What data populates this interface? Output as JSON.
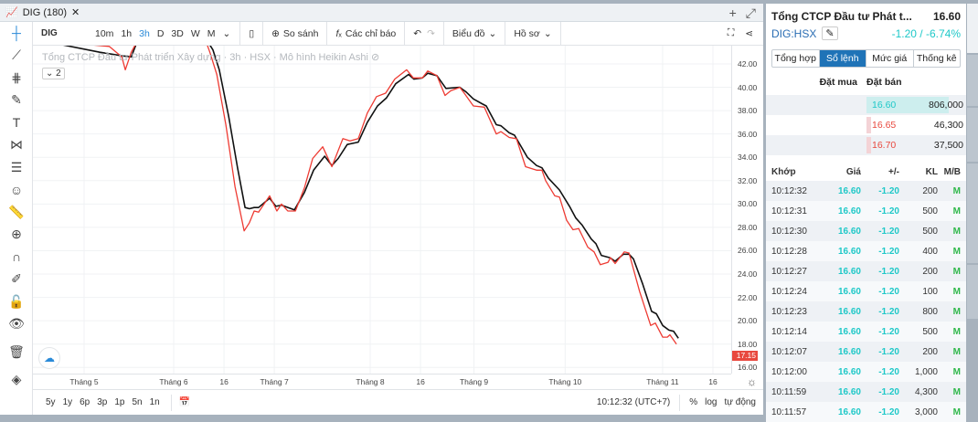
{
  "window": {
    "tab_title": "DIG (180)",
    "close": "✕",
    "add": "+",
    "expand": "⤢"
  },
  "toolbar": {
    "symbol": "DIG",
    "intervals": [
      "10m",
      "1h",
      "3h",
      "D",
      "3D",
      "W",
      "M"
    ],
    "active_interval": "3h",
    "compare": "So sánh",
    "indicators": "Các chỉ báo",
    "chart_type": "Biểu đồ",
    "profile": "Hồ sơ"
  },
  "legend": {
    "text": "Tổng CTCP Đầu tư Phát triển Xây dựng · 3h · HSX · Mô hình Heikin Ashi",
    "collapse": "2"
  },
  "bottom": {
    "ranges": [
      "5y",
      "1y",
      "6p",
      "3p",
      "1p",
      "5n",
      "1n"
    ],
    "clock": "10:12:32 (UTC+7)",
    "percent": "%",
    "log": "log",
    "auto": "tự động"
  },
  "chart_data": {
    "type": "line",
    "title": "Tổng CTCP Đầu tư Phát triển Xây dựng · 3h · HSX · Mô hình Heikin Ashi",
    "ylim": [
      15.5,
      43.5
    ],
    "y_ticks": [
      "42.00",
      "40.00",
      "38.00",
      "36.00",
      "34.00",
      "32.00",
      "30.00",
      "28.00",
      "26.00",
      "24.00",
      "22.00",
      "20.00",
      "18.00",
      "16.00"
    ],
    "x_ticks": [
      {
        "label": "Tháng 5",
        "x": 0
      },
      {
        "label": "Tháng 6",
        "x": 28.5
      },
      {
        "label": "16",
        "x": 44.5
      },
      {
        "label": "Tháng 7",
        "x": 60.5
      },
      {
        "label": "Tháng 8",
        "x": 91
      },
      {
        "label": "16",
        "x": 107
      },
      {
        "label": "Tháng 9",
        "x": 124
      },
      {
        "label": "Tháng 10",
        "x": 153
      },
      {
        "label": "Tháng 11",
        "x": 184
      },
      {
        "label": "16",
        "x": 200
      }
    ],
    "xlim": [
      -14,
      206
    ],
    "last_price": "17.15",
    "series": [
      {
        "name": "black",
        "color": "#111111",
        "points": [
          [
            -13.7,
            44
          ],
          [
            5,
            43
          ],
          [
            12,
            42.7
          ],
          [
            15,
            42.6
          ],
          [
            17,
            44
          ],
          [
            38,
            44.5
          ],
          [
            41,
            43.2
          ],
          [
            43,
            41.5
          ],
          [
            46,
            37.5
          ],
          [
            48.8,
            33.1
          ],
          [
            51.2,
            29.7
          ],
          [
            52.6,
            29.6
          ],
          [
            54.1,
            29.7
          ],
          [
            55.5,
            29.7
          ],
          [
            59,
            30.5
          ],
          [
            61,
            29.8
          ],
          [
            62.8,
            29.9
          ],
          [
            66.9,
            29.5
          ],
          [
            70.1,
            31
          ],
          [
            73,
            32.9
          ],
          [
            76.5,
            34.1
          ],
          [
            78.8,
            33.3
          ],
          [
            80.8,
            33.9
          ],
          [
            83.7,
            35.1
          ],
          [
            87.2,
            35.3
          ],
          [
            90.1,
            37
          ],
          [
            93.3,
            38.4
          ],
          [
            96.2,
            39.1
          ],
          [
            99.1,
            40.3
          ],
          [
            103.2,
            41.1
          ],
          [
            104.9,
            40.7
          ],
          [
            107.6,
            40.8
          ],
          [
            109.3,
            41.2
          ],
          [
            112.2,
            41
          ],
          [
            115.1,
            39.9
          ],
          [
            119.5,
            40
          ],
          [
            121.5,
            39.6
          ],
          [
            123.8,
            39
          ],
          [
            126.5,
            38.6
          ],
          [
            127.9,
            38.4
          ],
          [
            131.1,
            36.8
          ],
          [
            132.6,
            36.7
          ],
          [
            135.2,
            36.1
          ],
          [
            136.9,
            35.9
          ],
          [
            141,
            34
          ],
          [
            143.9,
            33.3
          ],
          [
            145.6,
            33.1
          ],
          [
            147.7,
            32.2
          ],
          [
            151.2,
            31.2
          ],
          [
            154.4,
            29.8
          ],
          [
            156.4,
            28.8
          ],
          [
            158.4,
            28.2
          ],
          [
            161.3,
            27
          ],
          [
            162.8,
            26.6
          ],
          [
            164.5,
            25.6
          ],
          [
            167.2,
            25.4
          ],
          [
            168.9,
            25.1
          ],
          [
            171.5,
            25.7
          ],
          [
            173.3,
            25.7
          ],
          [
            174.7,
            25.3
          ],
          [
            177.6,
            23.2
          ],
          [
            180.5,
            20.8
          ],
          [
            182,
            20.6
          ],
          [
            184,
            19.6
          ],
          [
            186,
            19.2
          ],
          [
            187.5,
            19.1
          ],
          [
            189,
            18.5
          ]
        ]
      },
      {
        "name": "red",
        "color": "#ee3b33",
        "points": [
          [
            -13.7,
            44
          ],
          [
            8,
            43.5
          ],
          [
            12,
            42.6
          ],
          [
            13.1,
            41.5
          ],
          [
            15,
            43
          ],
          [
            17,
            44
          ],
          [
            38,
            44.5
          ],
          [
            40,
            43
          ],
          [
            42.2,
            41.1
          ],
          [
            45.1,
            36.8
          ],
          [
            48,
            31.5
          ],
          [
            50.9,
            27.7
          ],
          [
            52.6,
            28.4
          ],
          [
            54.1,
            29.4
          ],
          [
            55.5,
            29.3
          ],
          [
            59,
            30.7
          ],
          [
            61.3,
            29.4
          ],
          [
            62.8,
            30
          ],
          [
            64.8,
            29.4
          ],
          [
            67.2,
            29.4
          ],
          [
            70.1,
            31.4
          ],
          [
            72.7,
            33.9
          ],
          [
            75.9,
            34.9
          ],
          [
            78.8,
            33.2
          ],
          [
            82.3,
            35.6
          ],
          [
            84.6,
            35.4
          ],
          [
            87.2,
            35.6
          ],
          [
            90.1,
            37.8
          ],
          [
            93,
            39.2
          ],
          [
            95.9,
            39.5
          ],
          [
            98.8,
            40.7
          ],
          [
            102.6,
            41.5
          ],
          [
            104.7,
            40.8
          ],
          [
            107.6,
            40.8
          ],
          [
            109.3,
            41.4
          ],
          [
            112.2,
            41
          ],
          [
            114.8,
            39.3
          ],
          [
            116.6,
            39.7
          ],
          [
            119.5,
            40
          ],
          [
            120.9,
            39.5
          ],
          [
            123.8,
            38.4
          ],
          [
            127.3,
            38.3
          ],
          [
            131.1,
            36
          ],
          [
            132.6,
            36.2
          ],
          [
            135.2,
            35.7
          ],
          [
            137.5,
            35.6
          ],
          [
            140.4,
            33.2
          ],
          [
            143.9,
            32.9
          ],
          [
            145.6,
            32.9
          ],
          [
            146.8,
            32
          ],
          [
            149.7,
            30.7
          ],
          [
            151.2,
            30.6
          ],
          [
            153.5,
            28.6
          ],
          [
            155.5,
            27.8
          ],
          [
            157.3,
            27.9
          ],
          [
            160.2,
            26.3
          ],
          [
            162.2,
            25.9
          ],
          [
            164.2,
            24.8
          ],
          [
            166.6,
            25
          ],
          [
            167.4,
            25.4
          ],
          [
            168.9,
            24.9
          ],
          [
            171.8,
            25.9
          ],
          [
            173.3,
            25.8
          ],
          [
            176.7,
            22.5
          ],
          [
            180.2,
            19.6
          ],
          [
            181.7,
            19.8
          ],
          [
            184,
            18.6
          ],
          [
            185.5,
            18.6
          ],
          [
            186.3,
            18.8
          ],
          [
            188.4,
            18.0
          ]
        ]
      }
    ]
  },
  "panel": {
    "company": "Tổng CTCP Đầu tư Phát t...",
    "price": "16.60",
    "ticker": "DIG:HSX",
    "change": "-1.20 / -6.74%",
    "tabs": [
      "Tổng hợp",
      "Sổ lệnh",
      "Mức giá",
      "Thống kê"
    ],
    "active_tab": "Sổ lệnh",
    "ob_headers": {
      "bid": "Đặt mua",
      "ask": "Đặt bán"
    },
    "orderbook": [
      {
        "price": "16.60",
        "vol": "806,000",
        "fill": 1.0,
        "color": "#1ec8c8"
      },
      {
        "price": "16.65",
        "vol": "46,300",
        "fill": 0.06,
        "color": "#e8483e"
      },
      {
        "price": "16.70",
        "vol": "37,500",
        "fill": 0.05,
        "color": "#e8483e"
      }
    ],
    "trade_headers": [
      "Khớp",
      "Giá",
      "+/-",
      "KL",
      "M/B"
    ],
    "trades": [
      [
        "10:12:32",
        "16.60",
        "-1.20",
        "200",
        "M"
      ],
      [
        "10:12:31",
        "16.60",
        "-1.20",
        "500",
        "M"
      ],
      [
        "10:12:30",
        "16.60",
        "-1.20",
        "500",
        "M"
      ],
      [
        "10:12:28",
        "16.60",
        "-1.20",
        "400",
        "M"
      ],
      [
        "10:12:27",
        "16.60",
        "-1.20",
        "200",
        "M"
      ],
      [
        "10:12:24",
        "16.60",
        "-1.20",
        "100",
        "M"
      ],
      [
        "10:12:23",
        "16.60",
        "-1.20",
        "800",
        "M"
      ],
      [
        "10:12:14",
        "16.60",
        "-1.20",
        "500",
        "M"
      ],
      [
        "10:12:07",
        "16.60",
        "-1.20",
        "200",
        "M"
      ],
      [
        "10:12:00",
        "16.60",
        "-1.20",
        "1,000",
        "M"
      ],
      [
        "10:11:59",
        "16.60",
        "-1.20",
        "4,300",
        "M"
      ],
      [
        "10:11:57",
        "16.60",
        "-1.20",
        "3,000",
        "M"
      ]
    ]
  }
}
